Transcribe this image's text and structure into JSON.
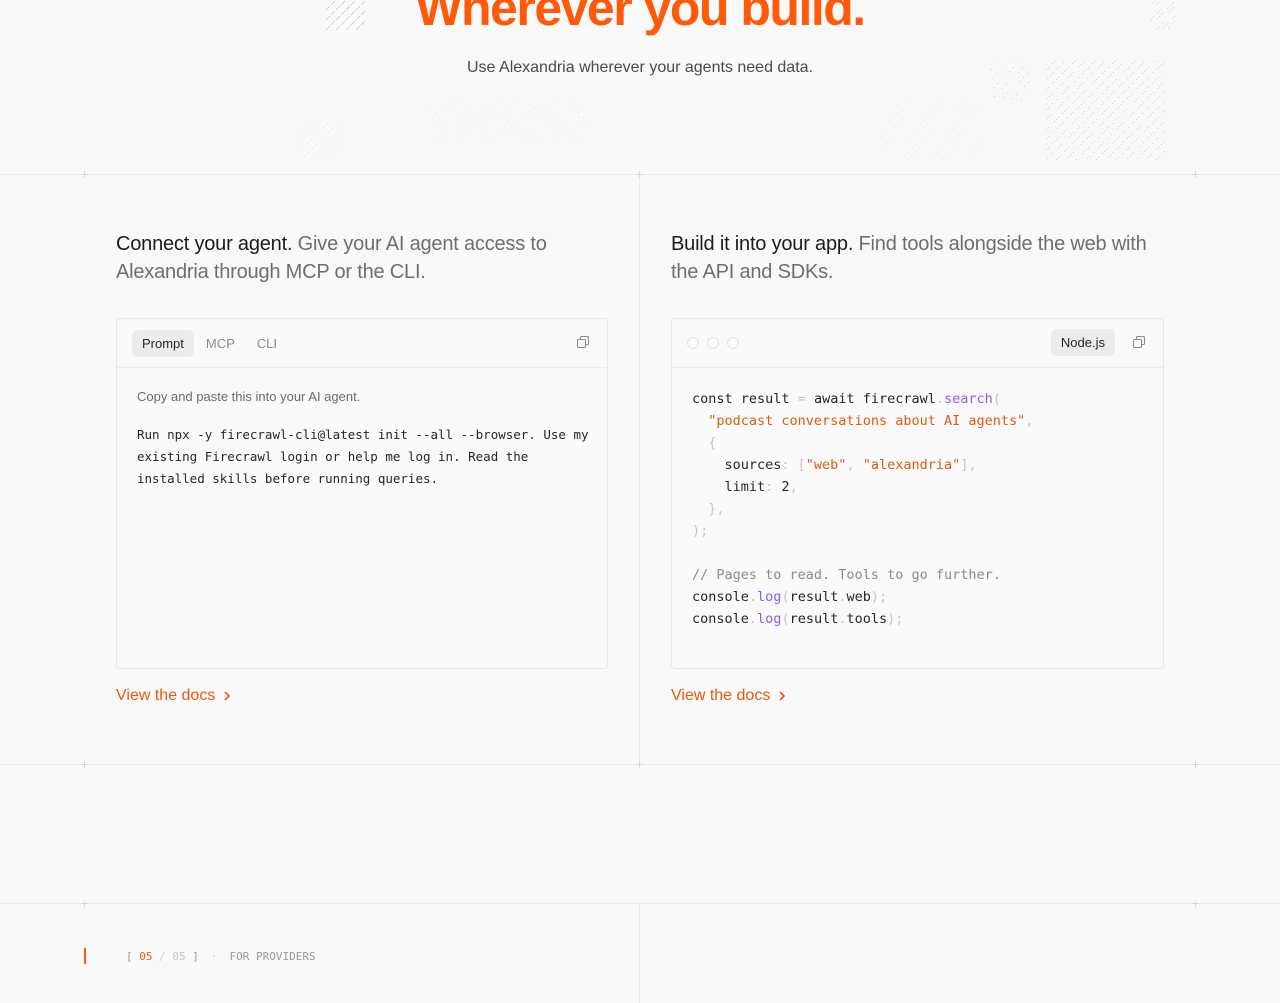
{
  "hero": {
    "title": "Wherever you build.",
    "subtitle": "Use Alexandria wherever your agents need data."
  },
  "agent_card": {
    "heading_strong": "Connect your agent.",
    "heading_rest": " Give your AI agent access to Alexandria through MCP or the CLI.",
    "tabs": [
      {
        "label": "Prompt",
        "active": true
      },
      {
        "label": "MCP",
        "active": false
      },
      {
        "label": "CLI",
        "active": false
      }
    ],
    "copy_icon": "copy-icon",
    "hint": "Copy and paste this into your AI agent.",
    "prompt": "Run npx -y firecrawl-cli@latest init --all --browser. Use my existing Firecrawl login or help me log in. Read the installed skills before running queries.",
    "docs_link": "View the docs"
  },
  "app_card": {
    "heading_strong": "Build it into your app.",
    "heading_rest": " Find tools alongside the web with the API and SDKs.",
    "language": "Node.js",
    "copy_icon": "copy-icon",
    "code_lines": [
      [
        [
          "t",
          "const result "
        ],
        [
          "p",
          "= "
        ],
        [
          "t",
          "await firecrawl"
        ],
        [
          "p",
          "."
        ],
        [
          "m",
          "search"
        ],
        [
          "p",
          "("
        ]
      ],
      [
        [
          "t",
          "  "
        ],
        [
          "s",
          "\"podcast conversations about AI agents\""
        ],
        [
          "p",
          ","
        ]
      ],
      [
        [
          "t",
          "  "
        ],
        [
          "p",
          "{"
        ]
      ],
      [
        [
          "t",
          "    sources"
        ],
        [
          "p",
          ": ["
        ],
        [
          "s",
          "\"web\""
        ],
        [
          "p",
          ", "
        ],
        [
          "s",
          "\"alexandria\""
        ],
        [
          "p",
          "],"
        ]
      ],
      [
        [
          "t",
          "    limit"
        ],
        [
          "p",
          ": "
        ],
        [
          "t",
          "2"
        ],
        [
          "p",
          ","
        ]
      ],
      [
        [
          "t",
          "  "
        ],
        [
          "p",
          "},"
        ]
      ],
      [
        [
          "p",
          ");"
        ]
      ],
      [
        [
          "t",
          ""
        ]
      ],
      [
        [
          "c",
          "// Pages to read. Tools to go further."
        ]
      ],
      [
        [
          "t",
          "console"
        ],
        [
          "p",
          "."
        ],
        [
          "m",
          "log"
        ],
        [
          "p",
          "("
        ],
        [
          "t",
          "result"
        ],
        [
          "p",
          "."
        ],
        [
          "t",
          "web"
        ],
        [
          "p",
          ");"
        ]
      ],
      [
        [
          "t",
          "console"
        ],
        [
          "p",
          "."
        ],
        [
          "m",
          "log"
        ],
        [
          "p",
          "("
        ],
        [
          "t",
          "result"
        ],
        [
          "p",
          "."
        ],
        [
          "t",
          "tools"
        ],
        [
          "p",
          ");"
        ]
      ]
    ],
    "docs_link": "View the docs"
  },
  "section": {
    "bracket_open": "[",
    "current": "05",
    "separator": "/",
    "total": "05",
    "bracket_close": "]",
    "dot": "·",
    "label": "FOR PROVIDERS"
  },
  "colors": {
    "accent": "#ff5a0a",
    "link": "#e8590c",
    "string": "#e05a10",
    "method": "#8b5cf6"
  }
}
